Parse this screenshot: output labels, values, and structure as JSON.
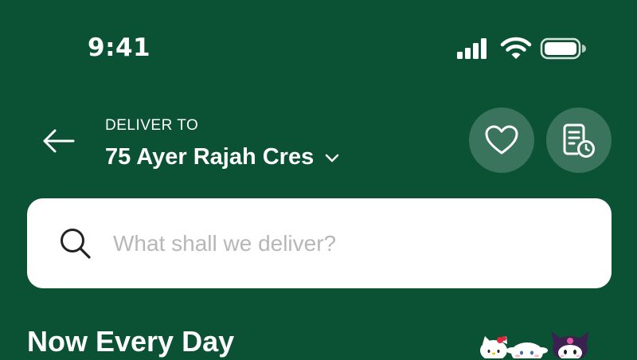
{
  "status_bar": {
    "time": "9:41",
    "icons": [
      "signal-icon",
      "wifi-icon",
      "battery-icon"
    ]
  },
  "header": {
    "back_icon": "arrow-left-icon",
    "deliver_label": "DELIVER TO",
    "address": "75 Ayer Rajah Cres",
    "address_dropdown_icon": "chevron-down-icon",
    "favourites_icon": "heart-icon",
    "orders_icon": "receipt-clock-icon"
  },
  "search": {
    "placeholder": "What shall we deliver?",
    "value": "",
    "icon": "search-icon"
  },
  "section": {
    "title": "Now Every Day",
    "decoration": "character-mascots-image"
  },
  "colors": {
    "background": "#0b5234",
    "button_tint": "rgba(255,255,255,0.20)",
    "search_bg": "#ffffff",
    "placeholder": "#b7b7b7"
  }
}
